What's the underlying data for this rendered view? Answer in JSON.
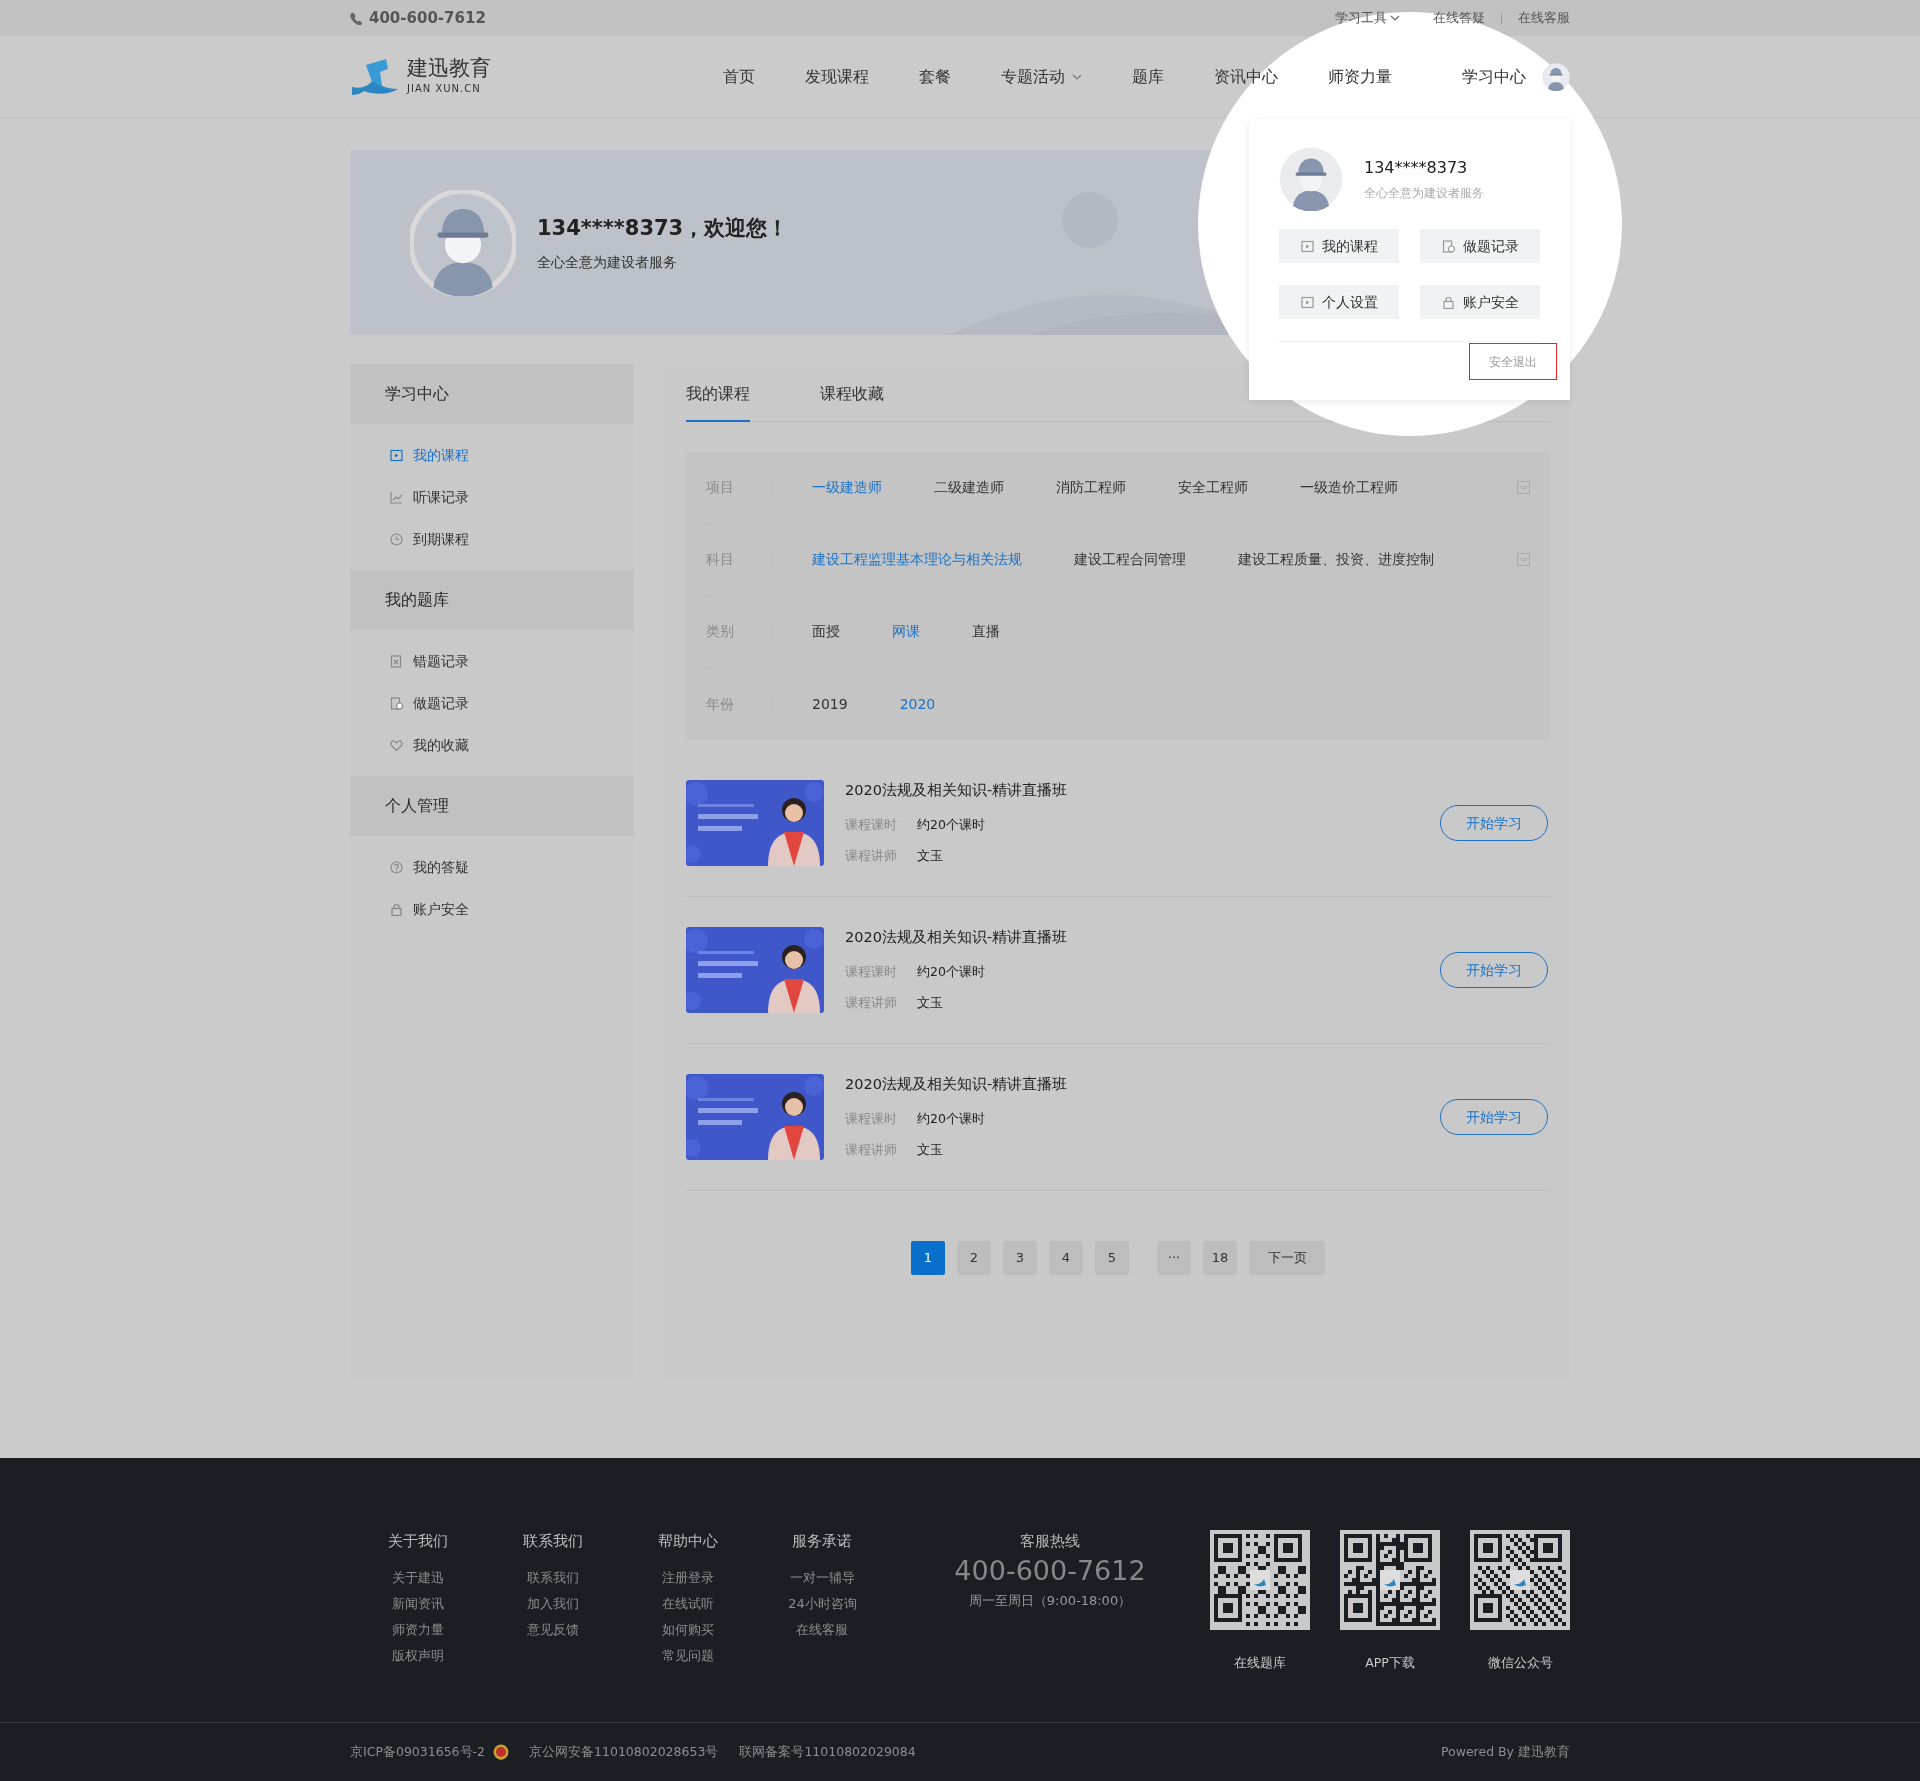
{
  "topbar": {
    "phone": "400-600-7612",
    "links": [
      {
        "label": "学习工具",
        "dropdown": true
      },
      {
        "label": "在线答疑",
        "dropdown": false
      },
      {
        "label": "在线客服",
        "dropdown": false
      }
    ]
  },
  "header": {
    "logo_name": "建迅教育",
    "logo_sub": "JIAN XUN.CN",
    "nav": [
      {
        "label": "首页",
        "dropdown": false
      },
      {
        "label": "发现课程",
        "dropdown": false
      },
      {
        "label": "套餐",
        "dropdown": false
      },
      {
        "label": "专题活动",
        "dropdown": true
      },
      {
        "label": "题库",
        "dropdown": false
      },
      {
        "label": "资讯中心",
        "dropdown": false
      },
      {
        "label": "师资力量",
        "dropdown": false
      }
    ],
    "user_link": "学习中心"
  },
  "user_menu": {
    "name": "134****8373",
    "tagline": "全心全意为建设者服务",
    "actions": [
      {
        "label": "我的课程",
        "kind": "video"
      },
      {
        "label": "做题记录",
        "kind": "record"
      },
      {
        "label": "个人设置",
        "kind": "video"
      },
      {
        "label": "账户安全",
        "kind": "lock"
      }
    ],
    "logout": "安全退出"
  },
  "banner": {
    "greeting": "134****8373，欢迎您！",
    "tagline": "全心全意为建设者服务"
  },
  "sidebar": {
    "groups": [
      {
        "title": "学习中心",
        "items": [
          {
            "label": "我的课程",
            "kind": "video",
            "selected": true
          },
          {
            "label": "听课记录",
            "kind": "chart",
            "selected": false
          },
          {
            "label": "到期课程",
            "kind": "clock",
            "selected": false
          }
        ]
      },
      {
        "title": "我的题库",
        "items": [
          {
            "label": "错题记录",
            "kind": "wrong",
            "selected": false
          },
          {
            "label": "做题记录",
            "kind": "record",
            "selected": false
          },
          {
            "label": "我的收藏",
            "kind": "heart",
            "selected": false
          }
        ]
      },
      {
        "title": "个人管理",
        "items": [
          {
            "label": "我的答疑",
            "kind": "question",
            "selected": false
          },
          {
            "label": "账户安全",
            "kind": "lock",
            "selected": false
          }
        ]
      }
    ]
  },
  "tabs": [
    {
      "label": "我的课程",
      "selected": true
    },
    {
      "label": "课程收藏",
      "selected": false
    }
  ],
  "filters": [
    {
      "label": "项目",
      "expandable": true,
      "options": [
        {
          "label": "一级建造师",
          "selected": true
        },
        {
          "label": "二级建造师",
          "selected": false
        },
        {
          "label": "消防工程师",
          "selected": false
        },
        {
          "label": "安全工程师",
          "selected": false
        },
        {
          "label": "一级造价工程师",
          "selected": false
        }
      ]
    },
    {
      "label": "科目",
      "expandable": true,
      "options": [
        {
          "label": "建设工程监理基本理论与相关法规",
          "selected": true
        },
        {
          "label": "建设工程合同管理",
          "selected": false
        },
        {
          "label": "建设工程质量、投资、进度控制",
          "selected": false
        }
      ]
    },
    {
      "label": "类别",
      "expandable": false,
      "options": [
        {
          "label": "面授",
          "selected": false
        },
        {
          "label": "网课",
          "selected": true
        },
        {
          "label": "直播",
          "selected": false
        }
      ]
    },
    {
      "label": "年份",
      "expandable": false,
      "options": [
        {
          "label": "2019",
          "selected": false
        },
        {
          "label": "2020",
          "selected": true
        }
      ]
    }
  ],
  "courses": [
    {
      "kind": "picture",
      "title": "2020法规及相关知识-精讲直播班",
      "hours_label": "课程课时",
      "hours": "约20个课时",
      "teacher_label": "课程讲师",
      "teacher": "文玉",
      "button": "开始学习"
    },
    {
      "kind": "picture",
      "title": "2020法规及相关知识-精讲直播班",
      "hours_label": "课程课时",
      "hours": "约20个课时",
      "teacher_label": "课程讲师",
      "teacher": "文玉",
      "button": "开始学习"
    },
    {
      "kind": "picture",
      "title": "2020法规及相关知识-精讲直播班",
      "hours_label": "课程课时",
      "hours": "约20个课时",
      "teacher_label": "课程讲师",
      "teacher": "文玉",
      "button": "开始学习"
    }
  ],
  "pagination": [
    {
      "label": "1",
      "kind": "page",
      "selected": true
    },
    {
      "label": "2",
      "kind": "page",
      "selected": false
    },
    {
      "label": "3",
      "kind": "page",
      "selected": false
    },
    {
      "label": "4",
      "kind": "page",
      "selected": false
    },
    {
      "label": "5",
      "kind": "page",
      "selected": false
    },
    {
      "label": "···",
      "kind": "ellipsis",
      "selected": false
    },
    {
      "label": "18",
      "kind": "page",
      "selected": false
    },
    {
      "label": "下一页",
      "kind": "next",
      "selected": false
    }
  ],
  "footer": {
    "columns": [
      {
        "title": "关于我们",
        "links": [
          "关于建迅",
          "新闻资讯",
          "师资力量",
          "版权声明"
        ]
      },
      {
        "title": "联系我们",
        "links": [
          "联系我们",
          "加入我们",
          "意见反馈"
        ]
      },
      {
        "title": "帮助中心",
        "links": [
          "注册登录",
          "在线试听",
          "如何购买",
          "常见问题"
        ]
      },
      {
        "title": "服务承诺",
        "links": [
          "一对一辅导",
          "24小时咨询",
          "在线客服"
        ]
      }
    ],
    "hotline": {
      "title": "客服热线",
      "number": "400-600-7612",
      "hours": "周一至周日（9:00-18:00）"
    },
    "qr_codes": [
      {
        "label": "在线题库"
      },
      {
        "label": "APP下载"
      },
      {
        "label": "微信公众号"
      }
    ],
    "icp": "京ICP备09031656号-2",
    "police": "京公网安备11010802028653号",
    "net_record": "联网备案号11010802029084",
    "powered": "Powered By 建迅教育"
  }
}
